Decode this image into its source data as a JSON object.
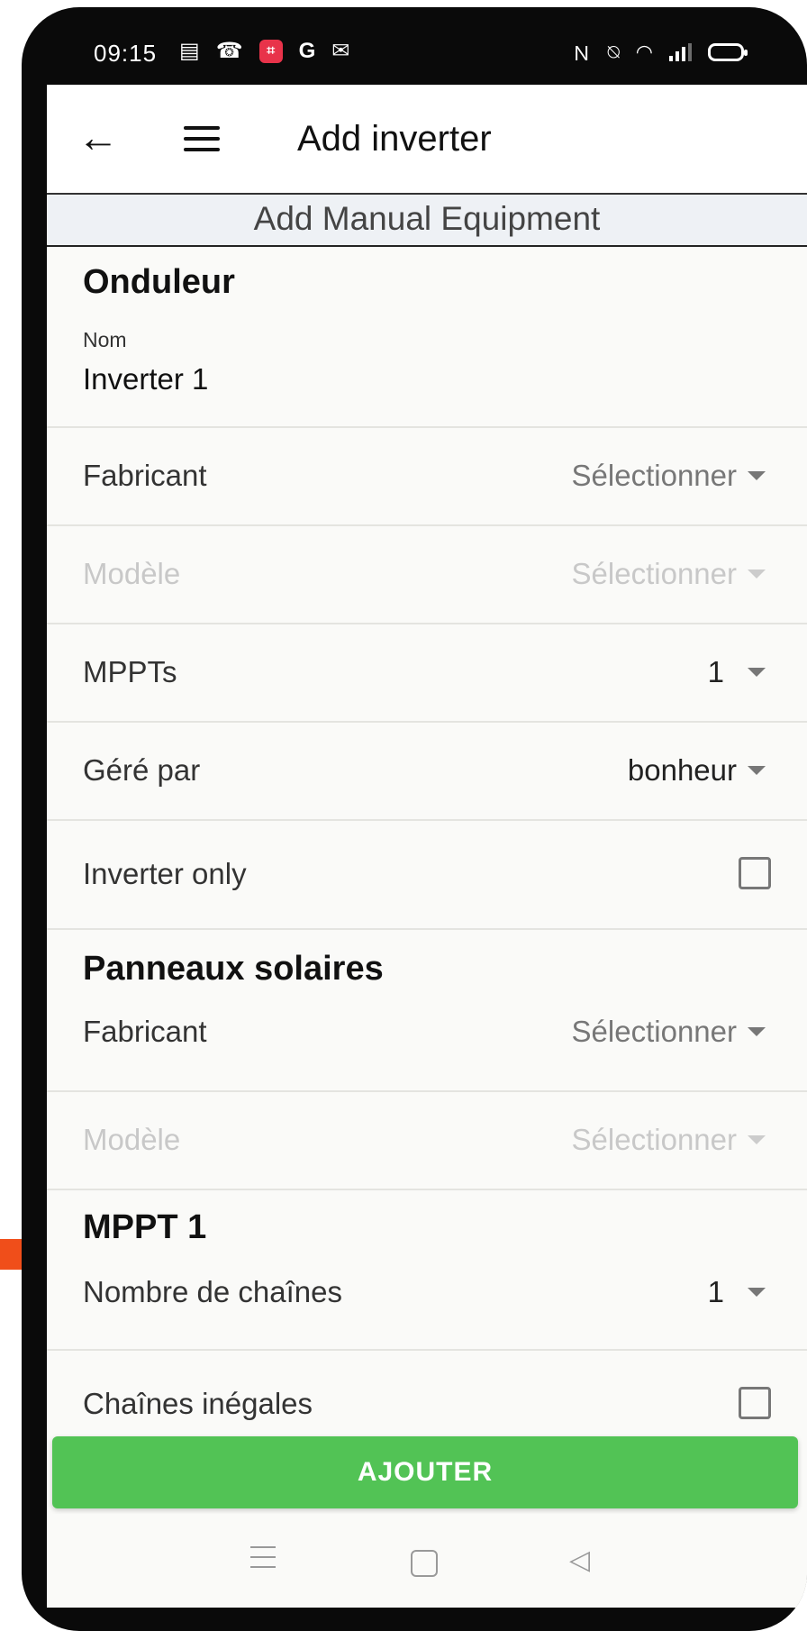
{
  "status_bar": {
    "time": "09:15",
    "left_icons": [
      "notes-icon",
      "phone-missed-icon",
      "crop-app-icon",
      "google-icon",
      "gmail-icon"
    ],
    "right_icons": [
      "nfc-icon",
      "vibrate-icon",
      "wifi-icon",
      "signal-icon",
      "battery-icon"
    ],
    "notif_badge_color": "#e8334a"
  },
  "appbar": {
    "title": "Add inverter"
  },
  "subheader": "Add Manual Equipment",
  "onduleur": {
    "section_title": "Onduleur",
    "name_label": "Nom",
    "name_value": "Inverter 1",
    "fabricant_label": "Fabricant",
    "fabricant_value": "Sélectionner",
    "modele_label": "Modèle",
    "modele_value": "Sélectionner",
    "mppts_label": "MPPTs",
    "mppts_value": "1",
    "gere_label": "Géré par",
    "gere_value": "bonheur",
    "inverter_only_label": "Inverter only"
  },
  "panneaux": {
    "section_title": "Panneaux solaires",
    "fabricant_label": "Fabricant",
    "fabricant_value": "Sélectionner",
    "modele_label": "Modèle",
    "modele_value": "Sélectionner"
  },
  "mppt1": {
    "section_title": "MPPT 1",
    "chaines_label": "Nombre de chaînes",
    "chaines_value": "1",
    "inegales_label": "Chaînes inégales"
  },
  "button": {
    "label": "AJOUTER",
    "color": "#52c355"
  }
}
